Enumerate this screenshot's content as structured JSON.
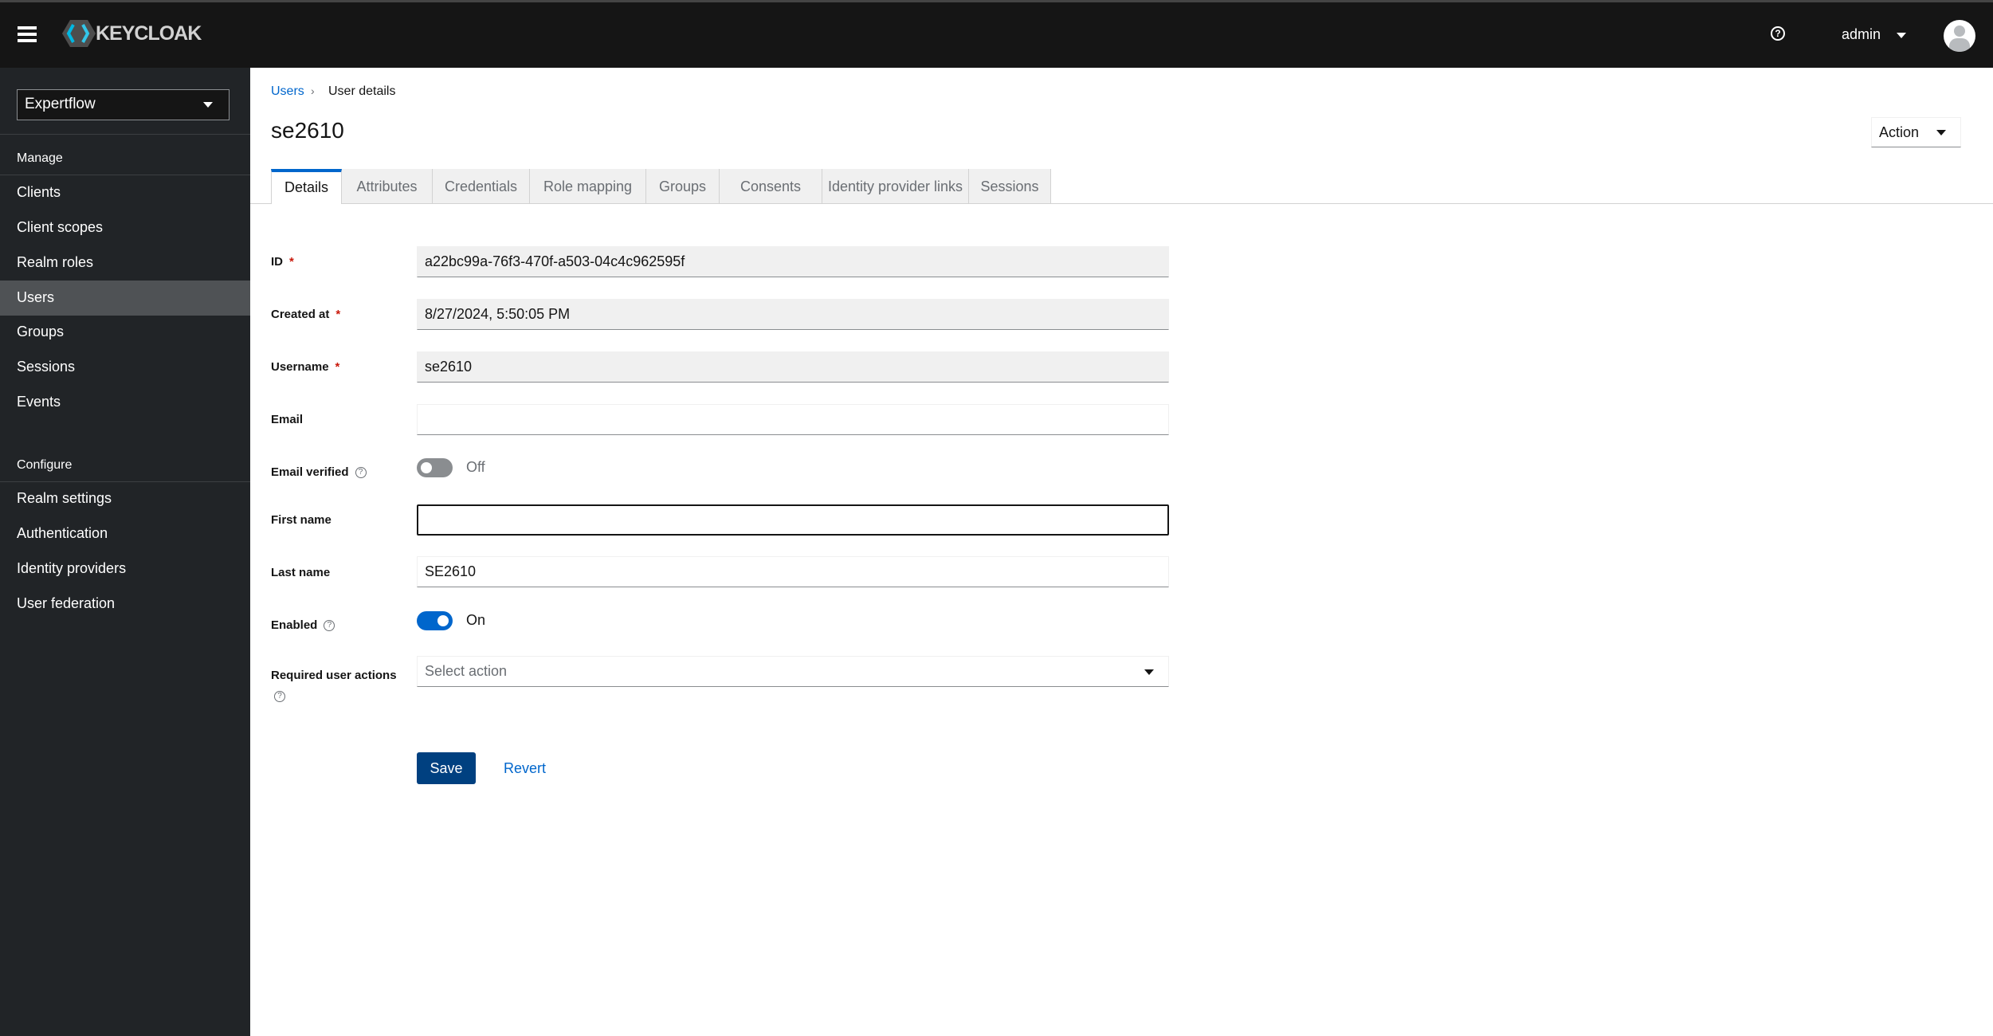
{
  "header": {
    "brand": "KEYCLOAK",
    "user": "admin",
    "icons": [
      "hamburger-icon",
      "help-icon",
      "avatar-icon"
    ]
  },
  "sidebar": {
    "realm": "Expertflow",
    "manage_label": "Manage",
    "manage_items": [
      {
        "label": "Clients"
      },
      {
        "label": "Client scopes"
      },
      {
        "label": "Realm roles"
      },
      {
        "label": "Users",
        "active": true
      },
      {
        "label": "Groups"
      },
      {
        "label": "Sessions"
      },
      {
        "label": "Events"
      }
    ],
    "configure_label": "Configure",
    "configure_items": [
      {
        "label": "Realm settings"
      },
      {
        "label": "Authentication"
      },
      {
        "label": "Identity providers"
      },
      {
        "label": "User federation"
      }
    ]
  },
  "breadcrumb": {
    "parent": "Users",
    "current": "User details"
  },
  "page": {
    "title": "se2610",
    "action_label": "Action"
  },
  "tabs": [
    "Details",
    "Attributes",
    "Credentials",
    "Role mapping",
    "Groups",
    "Consents",
    "Identity provider links",
    "Sessions"
  ],
  "form": {
    "id": {
      "label": "ID",
      "value": "a22bc99a-76f3-470f-a503-04c4c962595f"
    },
    "created": {
      "label": "Created at",
      "value": "8/27/2024, 5:50:05 PM"
    },
    "username": {
      "label": "Username",
      "value": "se2610"
    },
    "email": {
      "label": "Email",
      "value": ""
    },
    "email_verified": {
      "label": "Email verified",
      "state": "Off"
    },
    "first_name": {
      "label": "First name",
      "value": ""
    },
    "last_name": {
      "label": "Last name",
      "value": "SE2610"
    },
    "enabled": {
      "label": "Enabled",
      "state": "On"
    },
    "required_actions": {
      "label": "Required user actions",
      "placeholder": "Select action"
    },
    "required_mark": "*",
    "save": "Save",
    "revert": "Revert"
  },
  "colors": {
    "accent": "#0066cc",
    "save": "#004080",
    "header": "#151515",
    "sidebar": "#212427"
  }
}
